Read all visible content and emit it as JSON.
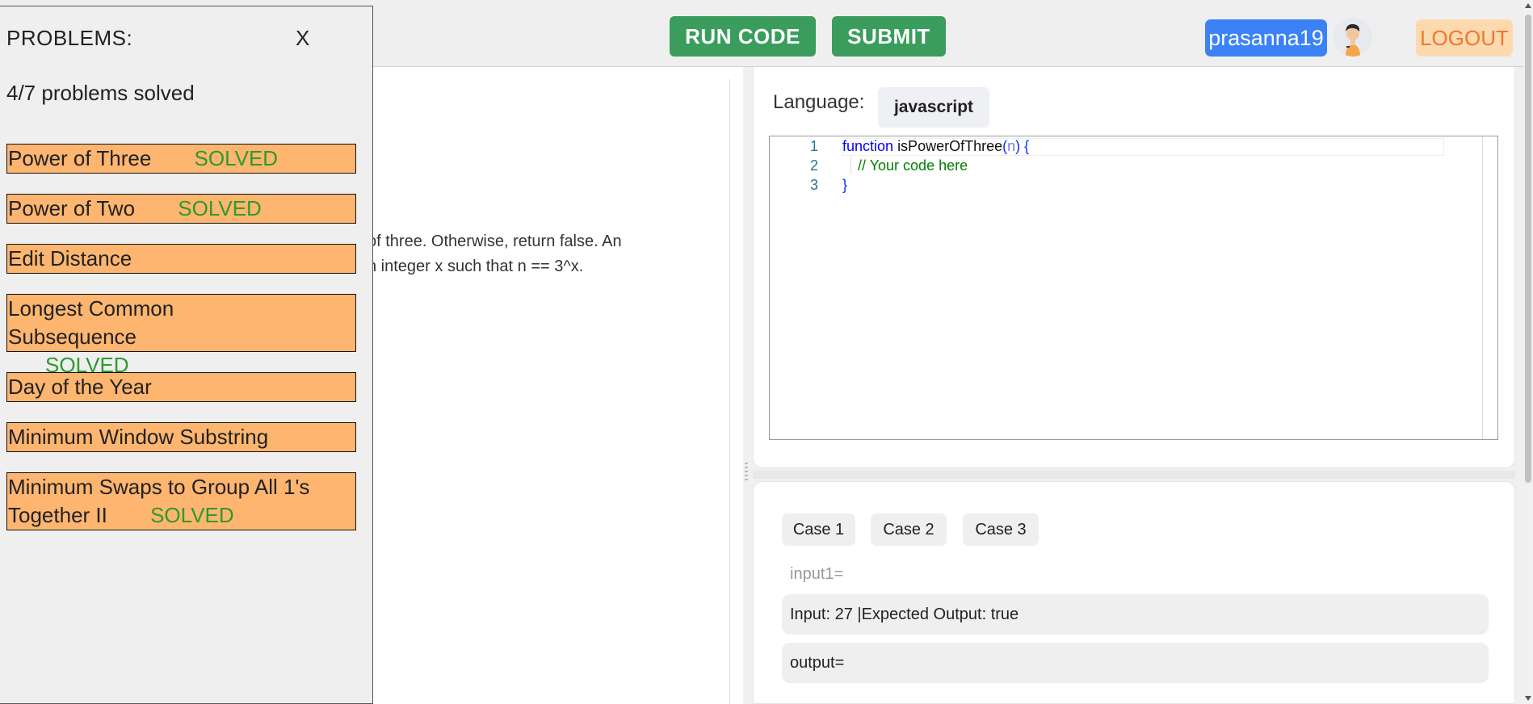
{
  "header": {
    "run_label": "RUN CODE",
    "submit_label": "SUBMIT",
    "username": "prasanna19",
    "logout_label": "LOGOUT"
  },
  "sidebar": {
    "title": "PROBLEMS:",
    "close_label": "X",
    "progress": "4/7 problems solved",
    "problems": [
      {
        "name": "Power of Three",
        "status": "SOLVED"
      },
      {
        "name": "Power of Two",
        "status": "SOLVED"
      },
      {
        "name": "Edit Distance",
        "status": ""
      },
      {
        "name": "Longest Common Subsequence",
        "status": "SOLVED"
      },
      {
        "name": "Day of the Year",
        "status": ""
      },
      {
        "name": "Minimum Window Substring",
        "status": ""
      },
      {
        "name": "Minimum Swaps to Group All 1's Together II",
        "status": "SOLVED"
      }
    ]
  },
  "description": {
    "line1": "of three. Otherwise, return false. An",
    "line2": "n integer x such that n == 3^x."
  },
  "editor": {
    "language_label": "Language:",
    "language": "javascript",
    "line_numbers": [
      "1",
      "2",
      "3"
    ],
    "code": {
      "kw": "function",
      "fn": "isPowerOfThree",
      "open_paren": "(",
      "param": "n",
      "close_paren": ")",
      "open_brace": "{",
      "comment": "// Your code here",
      "close_brace": "}"
    }
  },
  "tests": {
    "cases": [
      "Case 1",
      "Case 2",
      "Case 3"
    ],
    "input_label": "input1=",
    "input_value": "Input: 27 |Expected Output: true",
    "output_label": "output="
  },
  "colors": {
    "green_button": "#3a9d5d",
    "user_badge": "#3b82f6",
    "logout_bg": "#fdd9b0",
    "logout_text": "#f0782a",
    "problem_bg": "#fdb56f",
    "solved_text": "#2e9a2e"
  }
}
